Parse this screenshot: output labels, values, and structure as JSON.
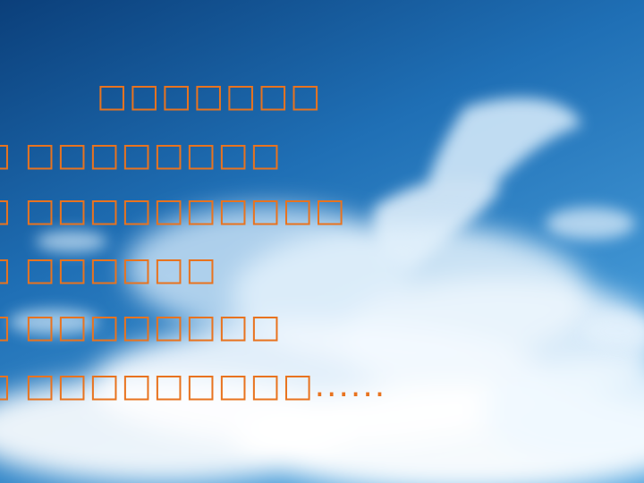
{
  "slide": {
    "title": "□□□□□□□",
    "lines": [
      "□ □□□□□□□□",
      "□ □□□□□□□□□□",
      "□ □□□□□□",
      "□ □□□□□□□□",
      "□ □□□□□□□□□......"
    ]
  },
  "colors": {
    "text": "#e8731f",
    "sky_top": "#0f4f8f",
    "sky_mid": "#2e86c8",
    "cloud": "#ffffff"
  }
}
